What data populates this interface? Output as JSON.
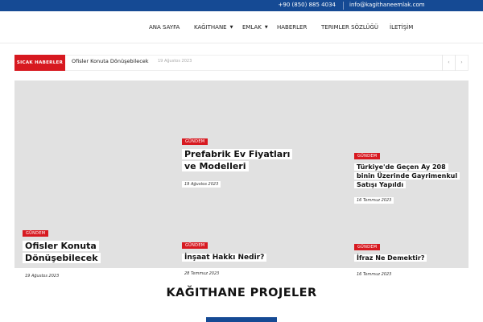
{
  "topbar": {
    "phone": "+90 (850) 885 4034",
    "email": "info@kagithaneemlak.com"
  },
  "nav": {
    "items": [
      {
        "label": "ANA SAYFA"
      },
      {
        "label": "KAĞITHANE"
      },
      {
        "label": "EMLAK"
      },
      {
        "label": "HABERLER"
      },
      {
        "label": "TERIMLER SÖZLÜĞÜ"
      },
      {
        "label": "İLETİŞİM"
      }
    ]
  },
  "breaking": {
    "tag": "SICAK HABERLER",
    "headline": "Ofisler Konuta Dönüşebilecek",
    "date": "19 Ağustos 2023",
    "prev_icon": "chevron-left-icon",
    "next_icon": "chevron-right-icon"
  },
  "hero": {
    "cards": [
      {
        "category": "GÜNDEM",
        "title": "Prefabrik Ev Fiyatları ve Modelleri",
        "date": "19 Ağustos 2023"
      },
      {
        "category": "GÜNDEM",
        "title": "Türkiye'de Geçen Ay 208 binin Üzerinde Gayrimenkul Satışı Yapıldı",
        "date": "16 Temmuz 2023"
      },
      {
        "category": "GÜNDEM",
        "title": "Ofisler Konuta Dönüşebilecek",
        "date": "19 Ağustos 2023"
      },
      {
        "category": "GÜNDEM",
        "title": "İnşaat Hakkı Nedir?",
        "date": "28 Temmuz 2023"
      },
      {
        "category": "GÜNDEM",
        "title": "İfraz Ne Demektir?",
        "date": "16 Temmuz 2023"
      }
    ]
  },
  "section": {
    "title": "KAĞITHANE PROJELER"
  },
  "colors": {
    "brand_blue": "#154a94",
    "accent_red": "#d71920",
    "hero_bg": "#e1e1e1"
  }
}
